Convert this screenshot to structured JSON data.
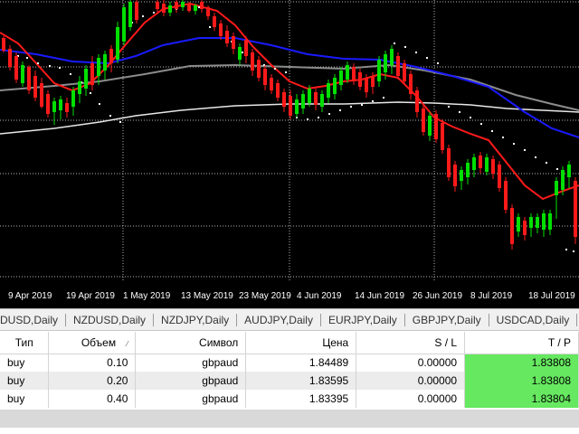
{
  "chart": {
    "background": "#000000",
    "date_labels": [
      "9 Apr 2019",
      "19 Apr 2019",
      "1 May 2019",
      "13 May 2019",
      "23 May 2019",
      "4 Jun 2019",
      "14 Jun 2019",
      "26 Jun 2019",
      "8 Jul 2019",
      "18 Jul 2019"
    ],
    "colors": {
      "bull": "#00e000",
      "bear": "#ff1a1a",
      "ma_fast": "#ff1a1a",
      "ma_mid": "#1a1aff",
      "ma_slow": "#8c8c8c",
      "ma_long": "#e8e8e8",
      "sar": "#ffffff",
      "grid": "#b4b4b4"
    }
  },
  "tabs": [
    "DUSD,Daily",
    "NZDUSD,Daily",
    "NZDJPY,Daily",
    "AUDJPY,Daily",
    "EURJPY,Daily",
    "GBPJPY,Daily",
    "USDCAD,Daily"
  ],
  "table": {
    "headers": {
      "type": "Тип",
      "volume": "Объем",
      "sort_indicator": "⁄",
      "symbol": "Символ",
      "price": "Цена",
      "sl": "S / L",
      "tp": "T / P"
    },
    "rows": [
      {
        "type": "buy",
        "volume": "0.10",
        "symbol": "gbpaud",
        "price": "1.84489",
        "sl": "0.00000",
        "tp": "1.83808"
      },
      {
        "type": "buy",
        "volume": "0.20",
        "symbol": "gbpaud",
        "price": "1.83595",
        "sl": "0.00000",
        "tp": "1.83808"
      },
      {
        "type": "buy",
        "volume": "0.40",
        "symbol": "gbpaud",
        "price": "1.83395",
        "sl": "0.00000",
        "tp": "1.83804"
      }
    ],
    "tp_color": "#66e860"
  }
}
